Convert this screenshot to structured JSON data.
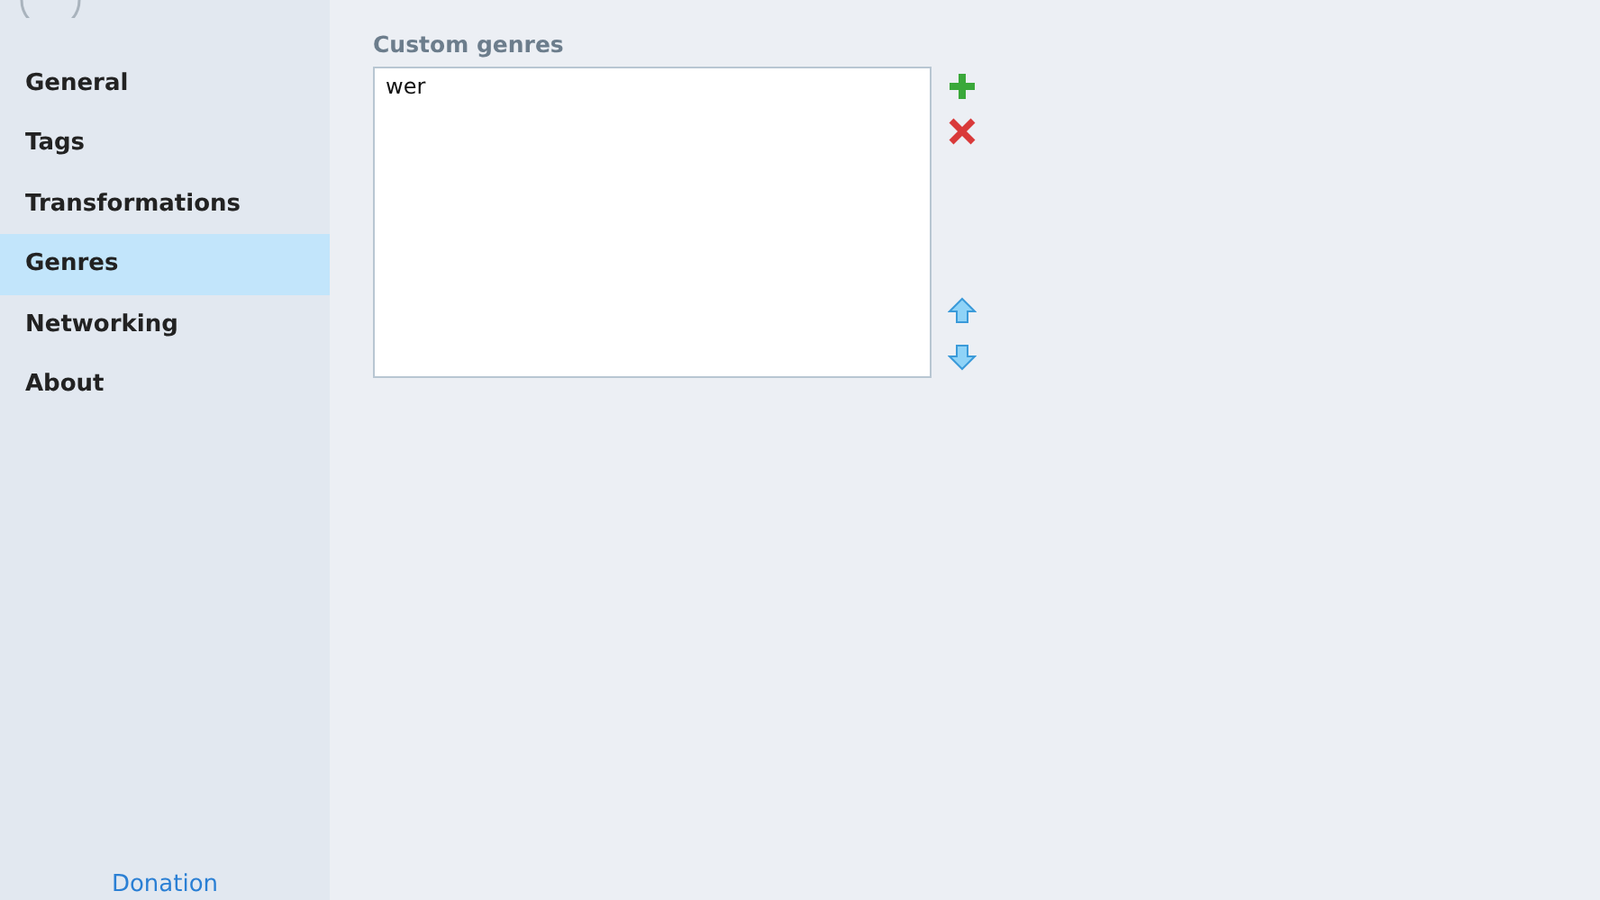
{
  "sidebar": {
    "items": [
      {
        "label": "General",
        "selected": false
      },
      {
        "label": "Tags",
        "selected": false
      },
      {
        "label": "Transformations",
        "selected": false
      },
      {
        "label": "Genres",
        "selected": true
      },
      {
        "label": "Networking",
        "selected": false
      },
      {
        "label": "About",
        "selected": false
      }
    ],
    "footer_link": "Donation"
  },
  "custom_genres": {
    "label": "Custom genres",
    "items": [
      {
        "label": "wer",
        "selected": false
      }
    ]
  }
}
